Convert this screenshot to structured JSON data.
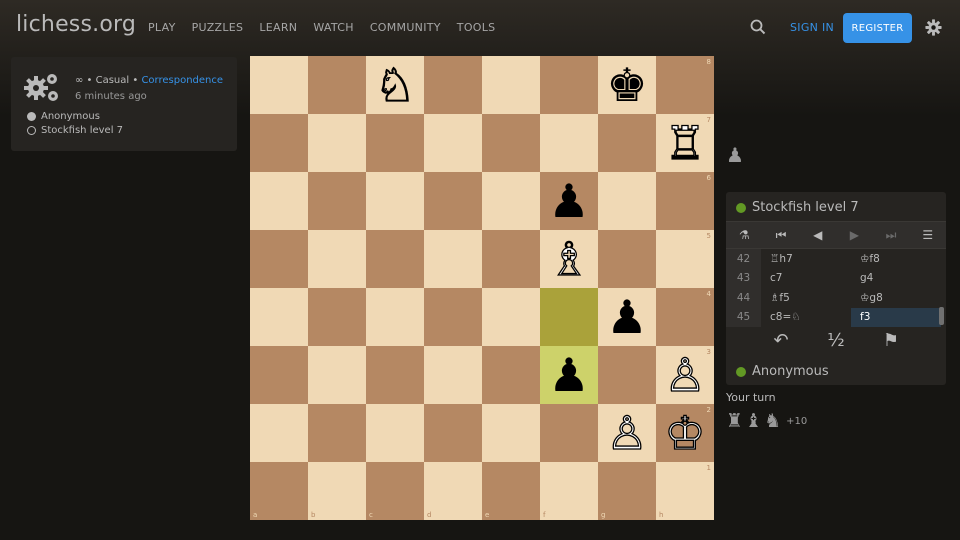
{
  "header": {
    "logo": "lichess.org",
    "nav": [
      "PLAY",
      "PUZZLES",
      "LEARN",
      "WATCH",
      "COMMUNITY",
      "TOOLS"
    ],
    "sign_in": "SIGN IN",
    "register": "REGISTER",
    "icons": [
      "search-icon",
      "gear-icon"
    ]
  },
  "game_info": {
    "speed": "∞",
    "sep1": " • ",
    "mode": "Casual",
    "sep2": " • ",
    "variant": "Correspondence",
    "time_ago": "6 minutes ago",
    "white_player": "Anonymous",
    "black_player": "Stockfish level 7"
  },
  "board": {
    "ranks": [
      "8",
      "7",
      "6",
      "5",
      "4",
      "3",
      "2",
      "1"
    ],
    "files": [
      "a",
      "b",
      "c",
      "d",
      "e",
      "f",
      "g",
      "h"
    ],
    "squares": [
      [
        "",
        "",
        "♘",
        "",
        "",
        "",
        "♚",
        ""
      ],
      [
        "",
        "",
        "",
        "",
        "",
        "",
        "",
        "♖"
      ],
      [
        "",
        "",
        "",
        "",
        "",
        "♟",
        "",
        ""
      ],
      [
        "",
        "",
        "",
        "",
        "",
        "♗",
        "",
        ""
      ],
      [
        "",
        "",
        "",
        "",
        "",
        "",
        "♟",
        ""
      ],
      [
        "",
        "",
        "",
        "",
        "",
        "♟",
        "",
        "♙"
      ],
      [
        "",
        "",
        "",
        "",
        "",
        "",
        "♙",
        "♔"
      ],
      [
        "",
        "",
        "",
        "",
        "",
        "",
        "",
        ""
      ]
    ],
    "highlight": [
      "f4",
      "f3"
    ]
  },
  "captured_top": "♟",
  "panel": {
    "top_player": "Stockfish level 7",
    "bottom_player": "Anonymous",
    "controls": [
      "analysis-icon",
      "first-move",
      "prev-move",
      "next-move",
      "last-move",
      "menu"
    ],
    "moves": [
      {
        "n": "42",
        "w": "♖h7",
        "b": "♔f8"
      },
      {
        "n": "43",
        "w": "c7",
        "b": "g4"
      },
      {
        "n": "44",
        "w": "♗f5",
        "b": "♔g8"
      },
      {
        "n": "45",
        "w": "c8=♘",
        "b": "f3"
      }
    ],
    "active_move": "f3",
    "actions": {
      "takeback": "↶",
      "draw": "½",
      "resign": "⚑"
    }
  },
  "your_turn": "Your turn",
  "captured_bottom": [
    "♜",
    "♝",
    "♞"
  ],
  "material_advantage": "+10",
  "colors": {
    "accent": "#3692e7",
    "online": "#629924",
    "light_square": "#f0d9b5",
    "dark_square": "#b58863"
  }
}
